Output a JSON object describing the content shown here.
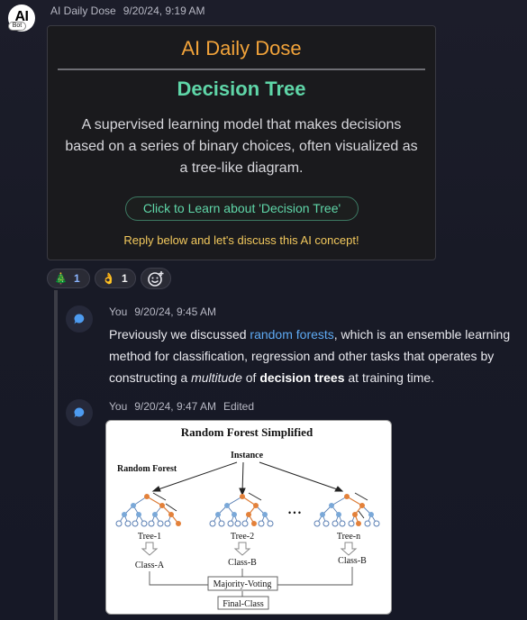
{
  "bot": {
    "avatar_text": "AI",
    "badge": "Bot",
    "name": "AI Daily Dose",
    "timestamp": "9/20/24, 9:19 AM"
  },
  "card": {
    "title": "AI Daily Dose",
    "heading": "Decision Tree",
    "description": "A supervised learning model that makes decisions based on a series of binary choices, often visualized as a tree-like diagram.",
    "button_label": "Click to Learn about 'Decision Tree'",
    "footer": "Reply below and let's discuss this AI concept!"
  },
  "reactions": [
    {
      "emoji": "🎄",
      "icon": "christmas-tree-icon",
      "count": "1"
    },
    {
      "emoji": "👌",
      "icon": "ok-hand-icon",
      "count": "1"
    }
  ],
  "add_reaction_icon": "add-reaction-smiley-icon",
  "messages": [
    {
      "author": "You",
      "timestamp": "9/20/24, 9:45 AM",
      "edited": "",
      "text_pre": "Previously we discussed ",
      "link": "random forests",
      "text_mid": ", which is an ensemble learning method for classification, regression and other tasks that operates by constructing a ",
      "italic": "multitude",
      "text_of": " of ",
      "bold": "decision trees",
      "text_post": " at training time."
    },
    {
      "author": "You",
      "timestamp": "9/20/24, 9:47 AM",
      "edited": "Edited"
    }
  ],
  "diagram": {
    "title": "Random Forest Simplified",
    "instance": "Instance",
    "left_label": "Random Forest",
    "ellipsis": "• • •",
    "trees": [
      "Tree-1",
      "Tree-2",
      "Tree-n"
    ],
    "classes": [
      "Class-A",
      "Class-B",
      "Class-B"
    ],
    "voting": "Majority-Voting",
    "final": "Final-Class"
  },
  "colors": {
    "accent_orange": "#f2a33a",
    "accent_green": "#5fd6a8",
    "footer_yellow": "#f3c95d",
    "link_blue": "#5eaaf3",
    "node_blue": "#7aa8d8",
    "node_orange": "#e3813a"
  }
}
